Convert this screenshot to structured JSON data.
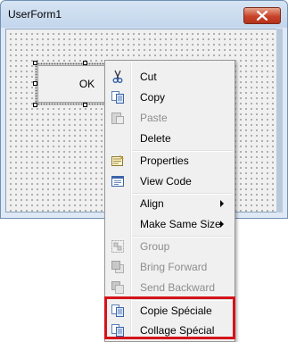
{
  "window": {
    "title": "UserForm1",
    "close_icon": "close-icon",
    "ok_button_label": "OK"
  },
  "context_menu": {
    "items": [
      {
        "label": "Cut",
        "icon": "scissors-icon",
        "enabled": true
      },
      {
        "label": "Copy",
        "icon": "copy-icon",
        "enabled": true
      },
      {
        "label": "Paste",
        "icon": "paste-icon",
        "enabled": false
      },
      {
        "label": "Delete",
        "icon": "",
        "enabled": true
      },
      {
        "label": "Properties",
        "icon": "properties-icon",
        "enabled": true
      },
      {
        "label": "View Code",
        "icon": "view-code-icon",
        "enabled": true
      },
      {
        "label": "Align",
        "icon": "",
        "enabled": true,
        "submenu": true
      },
      {
        "label": "Make Same Size",
        "icon": "",
        "enabled": true,
        "submenu": true
      },
      {
        "label": "Group",
        "icon": "group-icon",
        "enabled": false
      },
      {
        "label": "Bring Forward",
        "icon": "bring-forward-icon",
        "enabled": false
      },
      {
        "label": "Send Backward",
        "icon": "send-backward-icon",
        "enabled": false
      },
      {
        "label": "Copie Spéciale",
        "icon": "copy-special-icon",
        "enabled": true
      },
      {
        "label": "Collage Spécial",
        "icon": "paste-special-icon",
        "enabled": true
      }
    ]
  },
  "colors": {
    "highlight_border": "#d4141b",
    "close_button": "#c7432a",
    "disabled_text": "#8d8d8d"
  }
}
